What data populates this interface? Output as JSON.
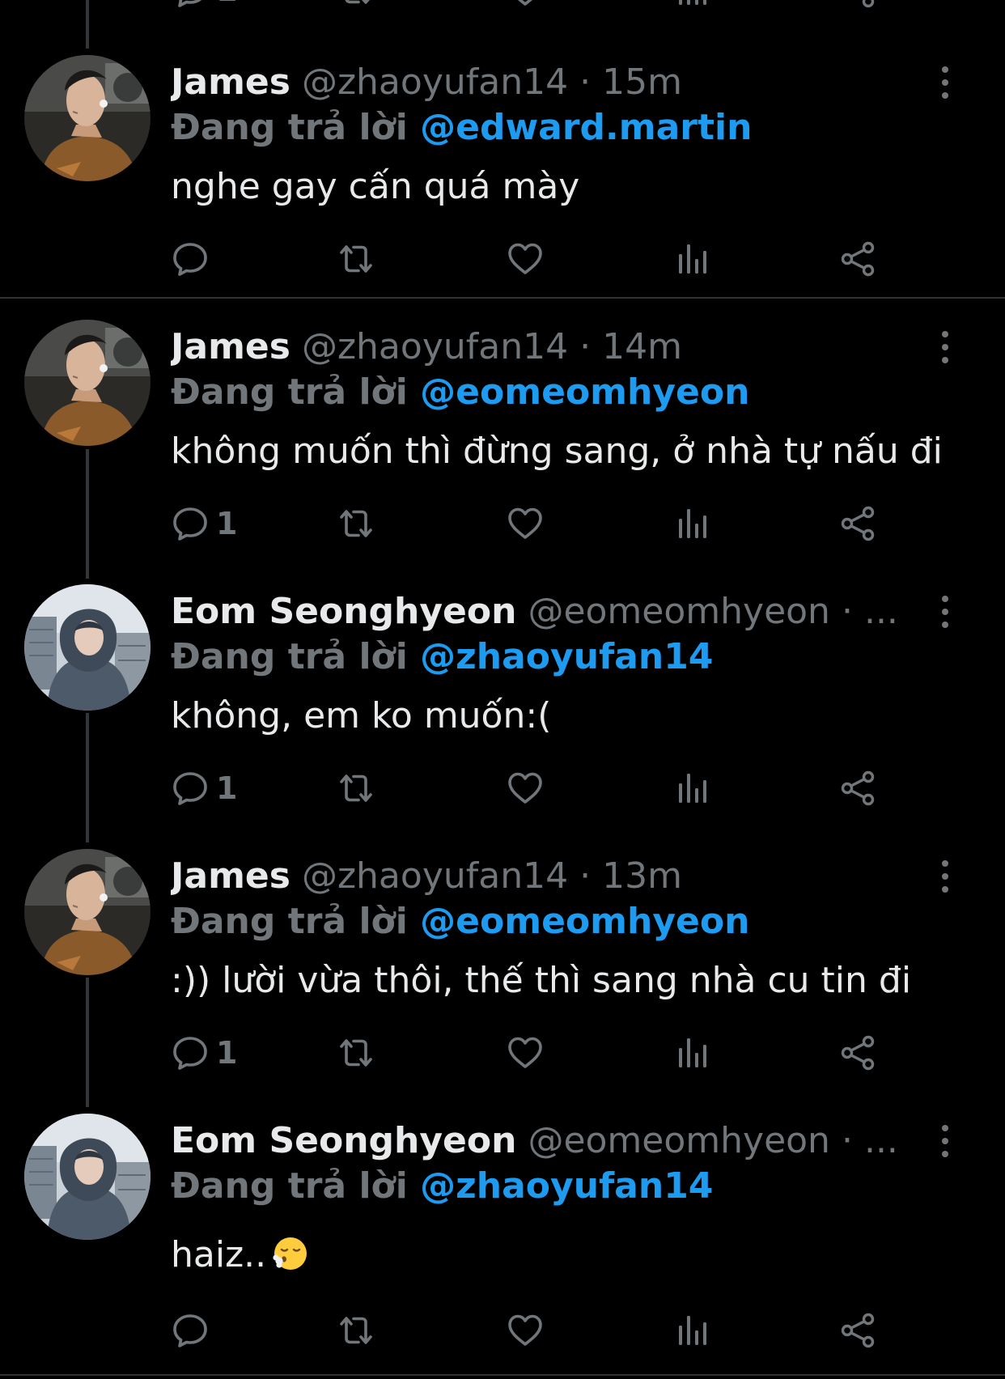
{
  "colors": {
    "background": "#000000",
    "text_primary": "#e7e9ea",
    "text_secondary": "#71767b",
    "mention": "#1d9bf0",
    "divider": "#2f3336"
  },
  "reply_prefix": "Đang trả lời",
  "tweets": [
    {
      "display_name": "James",
      "handle": "@zhaoyufan14",
      "separator": "·",
      "time": "15m",
      "reply_to": "@edward.martin",
      "text": "nghe gay cấn quá mày",
      "reply_count": "",
      "avatar": "avatar-james"
    },
    {
      "display_name": "James",
      "handle": "@zhaoyufan14",
      "separator": "·",
      "time": "14m",
      "reply_to": "@eomeomhyeon",
      "text": "không muốn thì đừng sang, ở nhà tự nấu đi",
      "reply_count": "1",
      "avatar": "avatar-james"
    },
    {
      "display_name": "Eom Seonghyeon",
      "handle": "@eomeomhyeon",
      "separator": "·",
      "time": "...",
      "reply_to": "@zhaoyufan14",
      "text": "không, em ko muốn:(",
      "reply_count": "1",
      "avatar": "avatar-eom"
    },
    {
      "display_name": "James",
      "handle": "@zhaoyufan14",
      "separator": "·",
      "time": "13m",
      "reply_to": "@eomeomhyeon",
      "text": ":)) lười vừa thôi, thế thì sang nhà cu tin đi",
      "reply_count": "1",
      "avatar": "avatar-james"
    },
    {
      "display_name": "Eom Seonghyeon",
      "handle": "@eomeomhyeon",
      "separator": "·",
      "time": "...",
      "reply_to": "@zhaoyufan14",
      "text": "haiz..",
      "text_emoji": "face-exhaling-emoji",
      "reply_count": "",
      "avatar": "avatar-eom"
    }
  ],
  "icons": {
    "reply": "reply-icon",
    "retweet": "retweet-icon",
    "like": "heart-icon",
    "views": "views-icon",
    "share": "share-icon",
    "more": "more-options-icon"
  }
}
